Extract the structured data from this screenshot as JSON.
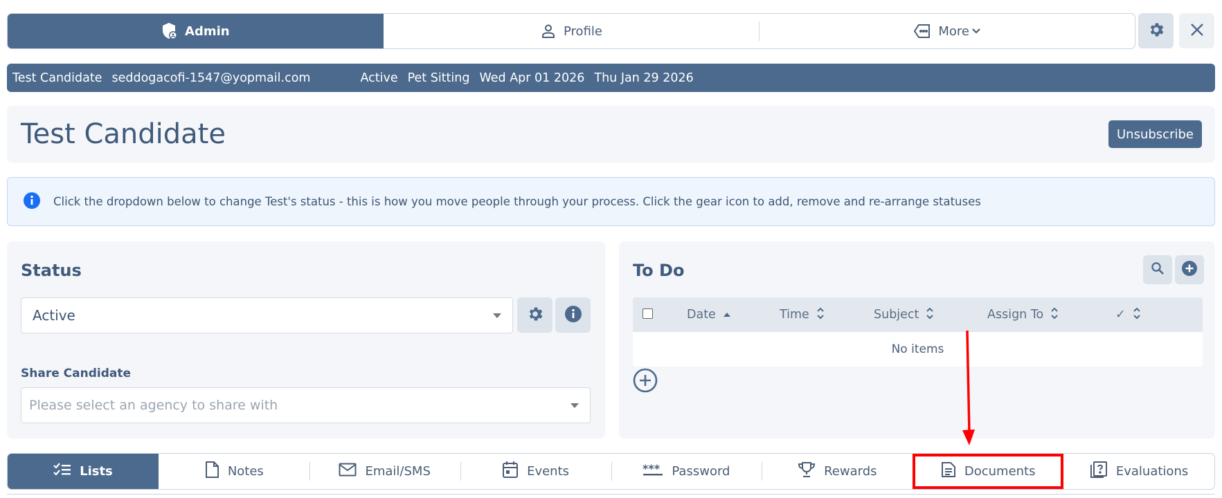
{
  "top_tabs": [
    {
      "label": "Admin",
      "icon": "shield-user-icon"
    },
    {
      "label": "Profile",
      "icon": "user-icon"
    },
    {
      "label": "More",
      "icon": "tag-icon"
    }
  ],
  "info_strip": {
    "name": "Test Candidate",
    "email": "seddogacofi-1547@yopmail.com",
    "status": "Active",
    "service": "Pet Sitting",
    "date1": "Wed Apr 01 2026",
    "date2": "Thu Jan 29 2026"
  },
  "header": {
    "title": "Test Candidate",
    "unsubscribe_label": "Unsubscribe"
  },
  "alert": {
    "text": "Click the dropdown below to change Test's status - this is how you move people through your process. Click the gear icon to add, remove and re-arrange statuses"
  },
  "status_card": {
    "title": "Status",
    "selected": "Active",
    "share_label": "Share Candidate",
    "share_placeholder": "Please select an agency to share with"
  },
  "todo_card": {
    "title": "To Do",
    "columns": [
      "Date",
      "Time",
      "Subject",
      "Assign To",
      "✓"
    ],
    "empty_text": "No items"
  },
  "bottom_tabs": [
    {
      "label": "Lists",
      "icon": "checklist-icon"
    },
    {
      "label": "Notes",
      "icon": "file-icon"
    },
    {
      "label": "Email/SMS",
      "icon": "envelope-icon"
    },
    {
      "label": "Events",
      "icon": "calendar-icon"
    },
    {
      "label": "Password",
      "icon": "asterisks-icon"
    },
    {
      "label": "Rewards",
      "icon": "trophy-icon"
    },
    {
      "label": "Documents",
      "icon": "document-icon"
    },
    {
      "label": "Evaluations",
      "icon": "question-file-icon"
    }
  ],
  "colors": {
    "primary": "#4c6a8d",
    "highlight": "#ff0000",
    "alert_bg": "#eef5fd",
    "card_bg": "#f4f6f9"
  }
}
